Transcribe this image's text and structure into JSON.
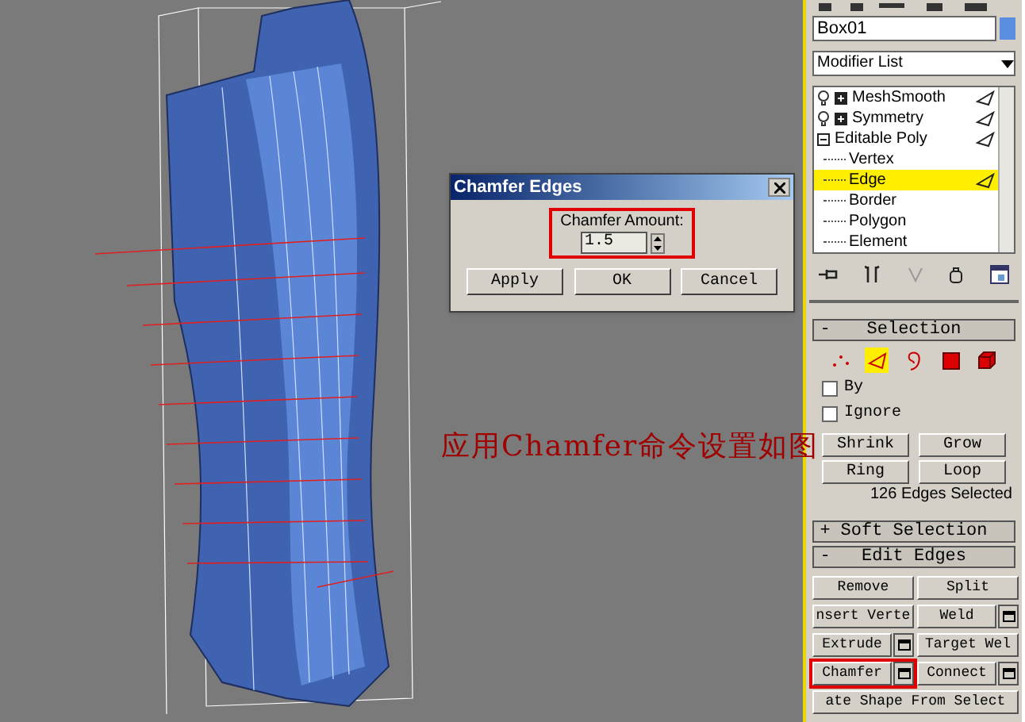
{
  "name_field": {
    "value": "Box01"
  },
  "modifier_list": {
    "label": "Modifier List"
  },
  "stack": [
    {
      "label": "MeshSmooth",
      "expanded": false,
      "selected": false
    },
    {
      "label": "Symmetry",
      "expanded": false,
      "selected": false
    },
    {
      "label": "Editable Poly",
      "expanded": true,
      "selected": false,
      "children": [
        {
          "label": "Vertex",
          "selected": false
        },
        {
          "label": "Edge",
          "selected": true
        },
        {
          "label": "Border",
          "selected": false
        },
        {
          "label": "Polygon",
          "selected": false
        },
        {
          "label": "Element",
          "selected": false
        }
      ]
    }
  ],
  "selection": {
    "sign": "-",
    "title": "Selection",
    "levels": [
      {
        "kind": "vertex",
        "selected": false
      },
      {
        "kind": "edge",
        "selected": true
      },
      {
        "kind": "border",
        "selected": false
      },
      {
        "kind": "polygon",
        "selected": false
      },
      {
        "kind": "element",
        "selected": false
      }
    ],
    "checkboxes": [
      {
        "label": "By",
        "checked": false
      },
      {
        "label": "Ignore",
        "checked": false
      }
    ],
    "buttons": [
      "Shrink",
      "Grow",
      "Ring",
      "Loop"
    ],
    "status": "126 Edges Selected"
  },
  "rollouts": [
    {
      "sign": "+",
      "title": "Soft Selection"
    },
    {
      "sign": "-",
      "title": "Edit Edges",
      "buttons": [
        {
          "label": "Remove",
          "settings": false,
          "highlighted": false,
          "wide": false
        },
        {
          "label": "Split",
          "settings": false,
          "highlighted": false,
          "wide": false
        },
        {
          "label": "nsert Verte",
          "settings": false,
          "highlighted": false,
          "wide": false
        },
        {
          "label": "Weld",
          "settings": true,
          "highlighted": false,
          "wide": false
        },
        {
          "label": "Extrude",
          "settings": true,
          "highlighted": false,
          "wide": false
        },
        {
          "label": "Target Wel",
          "settings": false,
          "highlighted": false,
          "wide": false
        },
        {
          "label": "Chamfer",
          "settings": true,
          "highlighted": true,
          "wide": false
        },
        {
          "label": "Connect",
          "settings": true,
          "highlighted": false,
          "wide": false
        },
        {
          "label": "ate Shape From Select",
          "settings": false,
          "highlighted": false,
          "wide": true
        }
      ]
    }
  ],
  "dialog": {
    "title": "Chamfer Edges",
    "field_label": "Chamfer Amount:",
    "value": "1.5",
    "highlighted": true,
    "buttons": [
      "Apply",
      "OK",
      "Cancel"
    ]
  },
  "caption": {
    "text": "应用Chamfer命令设置如图"
  }
}
